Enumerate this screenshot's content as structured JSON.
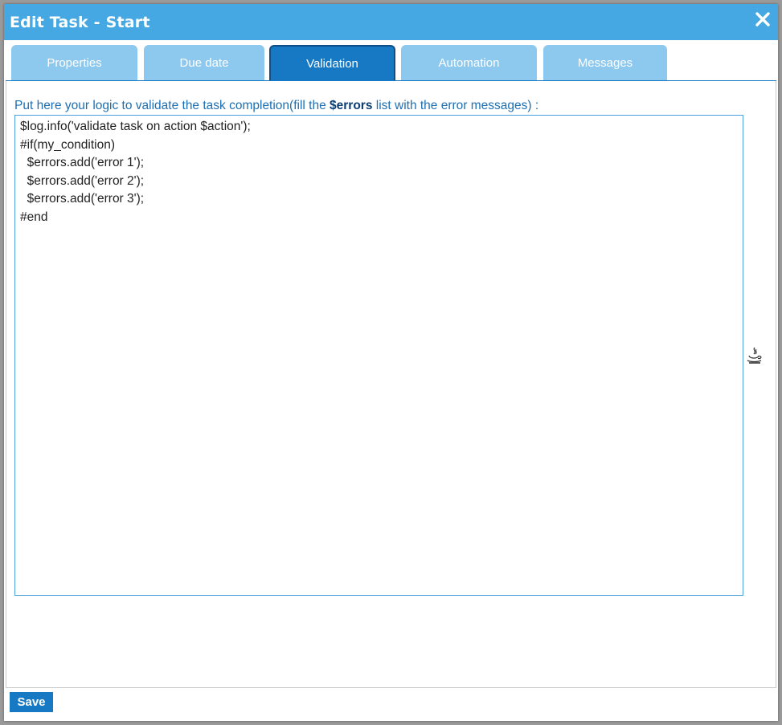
{
  "dialog": {
    "title": "Edit Task - Start",
    "close_icon": "close-icon"
  },
  "tabs": [
    {
      "label": "Properties",
      "active": false
    },
    {
      "label": "Due date",
      "active": false
    },
    {
      "label": "Validation",
      "active": true
    },
    {
      "label": "Automation",
      "active": false
    },
    {
      "label": "Messages",
      "active": false
    }
  ],
  "validation": {
    "instruction_before": "Put here your logic to validate the task completion(fill the ",
    "instruction_keyword": "$errors",
    "instruction_after": " list with the error messages) :",
    "script_value": "$log.info('validate task on action $action');\n#if(my_condition)\n  $errors.add('error 1');\n  $errors.add('error 2');\n  $errors.add('error 3');\n#end",
    "editor_icon": "java-icon"
  },
  "footer": {
    "save_label": "Save"
  },
  "colors": {
    "titlebar": "#45a8e3",
    "tab_inactive": "#8dc8ee",
    "tab_active": "#1778c3",
    "instruction_text": "#1d6fb3",
    "save_button": "#1778c3"
  }
}
